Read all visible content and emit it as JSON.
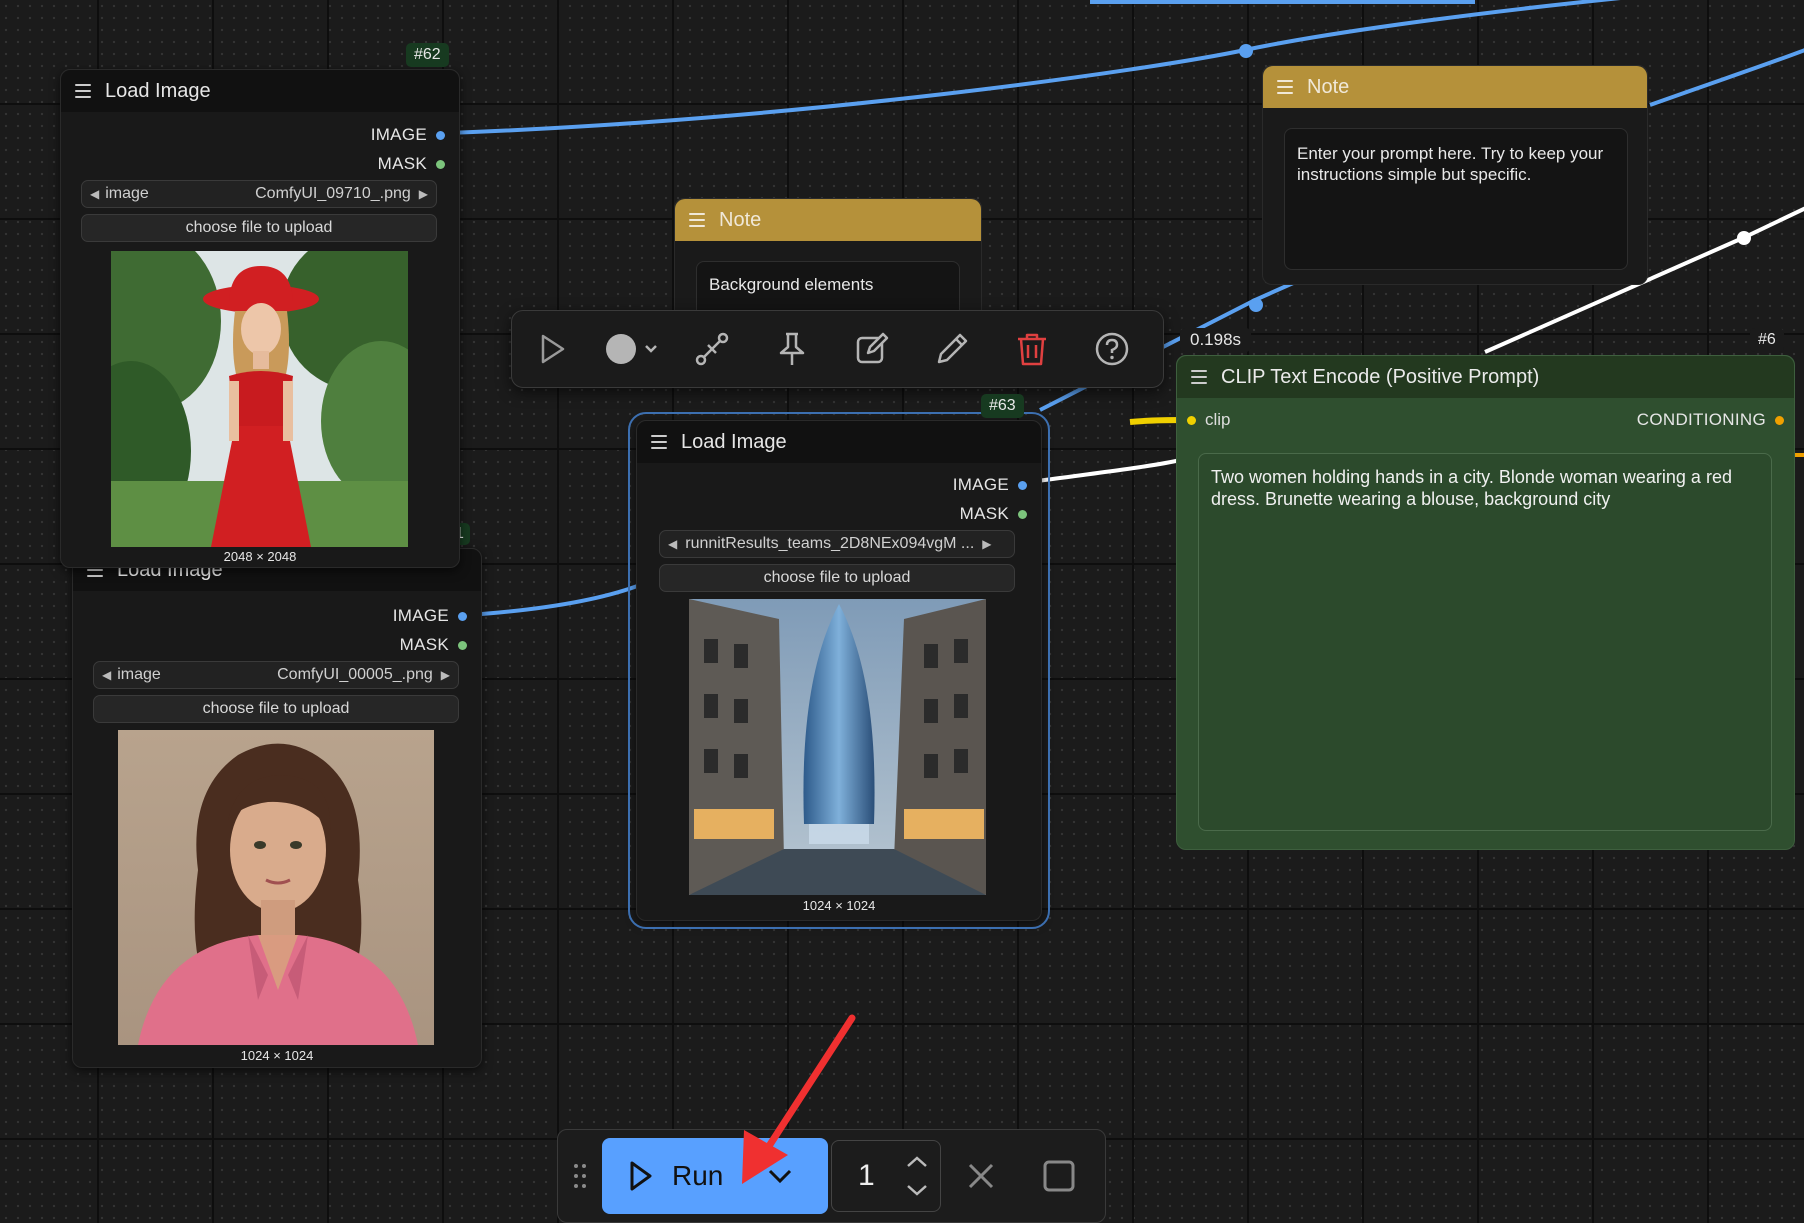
{
  "colors": {
    "accent": "#4a90ff",
    "image_link": "#5aa0f0",
    "mask_dot": "#7cc47c",
    "clip_dot": "#f0d000",
    "note_header": "#b5913a",
    "clip_node_bg": "#2f4f2f",
    "delete_icon": "#e04040",
    "annotation_arrow": "#f03030"
  },
  "node_62": {
    "id": "#62",
    "title": "Load Image",
    "outputs": [
      "IMAGE",
      "MASK"
    ],
    "image_label": "image",
    "image_value": "ComfyUI_09710_.png",
    "upload_label": "choose file to upload",
    "preview_subject": "woman in red dress and red hat in garden",
    "dimensions": "2048 × 2048"
  },
  "node_hidden": {
    "id_fragment": "1",
    "title": "Load Image",
    "outputs": [
      "IMAGE",
      "MASK"
    ],
    "image_label": "image",
    "image_value": "ComfyUI_00005_.png",
    "upload_label": "choose file to upload",
    "preview_subject": "brunette woman in pink blouse portrait",
    "dimensions": "1024 × 1024"
  },
  "node_63": {
    "id": "#63",
    "title": "Load Image",
    "outputs": [
      "IMAGE",
      "MASK"
    ],
    "image_value": "runnitResults_teams_2D8NEx094vgM ...",
    "upload_label": "choose file to upload",
    "preview_subject": "city street with glass skyscraper",
    "dimensions": "1024 × 1024"
  },
  "note_center": {
    "title": "Note",
    "text": "Background elements"
  },
  "note_right": {
    "title": "Note",
    "text": "Enter your prompt here.  Try to keep your instructions simple but specific."
  },
  "clip_node": {
    "id": "#6",
    "timing": "0.198s",
    "title": "CLIP Text Encode (Positive Prompt)",
    "input": "clip",
    "output": "CONDITIONING",
    "prompt": "Two women holding hands in a city.  Blonde woman wearing a red dress.  Brunette wearing a blouse, background city"
  },
  "toolbar": {
    "icons": [
      "play-icon",
      "color-circle-icon",
      "bypass-icon",
      "pin-icon",
      "edit-icon",
      "pencil-icon",
      "trash-icon",
      "help-icon"
    ]
  },
  "runbar": {
    "run_label": "Run",
    "batch_count": "1"
  }
}
